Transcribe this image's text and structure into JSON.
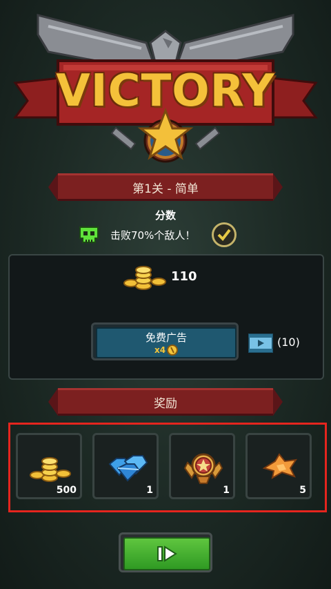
{
  "header": {
    "title": "VICTORY",
    "level_label": "第1关 - 简单"
  },
  "score": {
    "label": "分数",
    "objective": "击败70%个敌人！",
    "objective_completed": true
  },
  "earned": {
    "coins": "110"
  },
  "ad_offer": {
    "label": "免费广告",
    "multiplier": "x4",
    "remaining": "(10)"
  },
  "rewards": {
    "title": "奖励",
    "items": [
      {
        "icon": "gold-coins-icon",
        "quantity": "500"
      },
      {
        "icon": "blue-gems-icon",
        "quantity": "1"
      },
      {
        "icon": "star-medal-icon",
        "quantity": "1"
      },
      {
        "icon": "orange-part-icon",
        "quantity": "5"
      }
    ]
  },
  "colors": {
    "ribbon": "#7c2020",
    "gold": "#f4c13a",
    "continue_green": "#4cb832",
    "highlight_frame": "#e5251e"
  }
}
